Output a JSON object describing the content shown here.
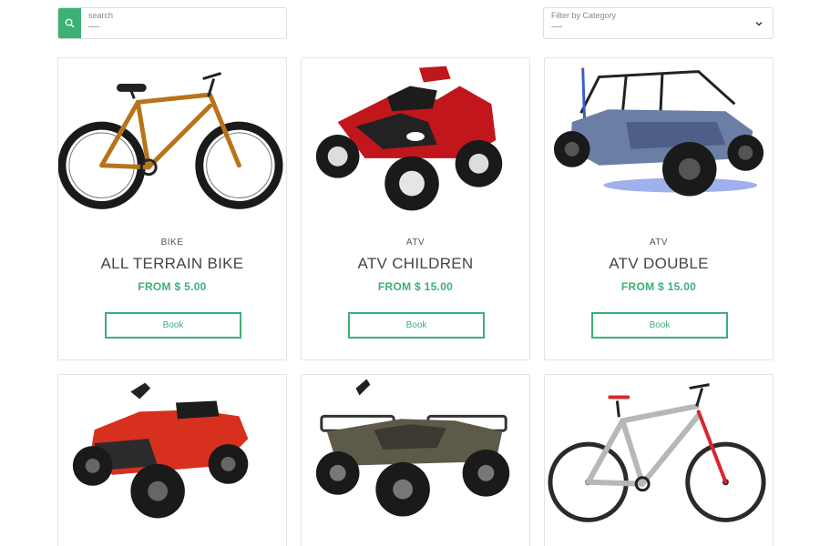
{
  "search": {
    "label": "search",
    "value": "----"
  },
  "filter": {
    "label": "Filter by Category",
    "value": "----"
  },
  "colors": {
    "accent": "#3bb077",
    "border": "#e3e3e3"
  },
  "products": [
    {
      "category": "BIKE",
      "title": "ALL TERRAIN BIKE",
      "price": "FROM $ 5.00",
      "book_label": "Book",
      "image": "fat-tire-bike"
    },
    {
      "category": "ATV",
      "title": "ATV CHILDREN",
      "price": "FROM $ 15.00",
      "book_label": "Book",
      "image": "kids-atv"
    },
    {
      "category": "ATV",
      "title": "ATV DOUBLE",
      "price": "FROM $ 15.00",
      "book_label": "Book",
      "image": "utv-buggy"
    },
    {
      "image": "red-atv"
    },
    {
      "image": "camo-atv"
    },
    {
      "image": "mountain-bike"
    }
  ]
}
